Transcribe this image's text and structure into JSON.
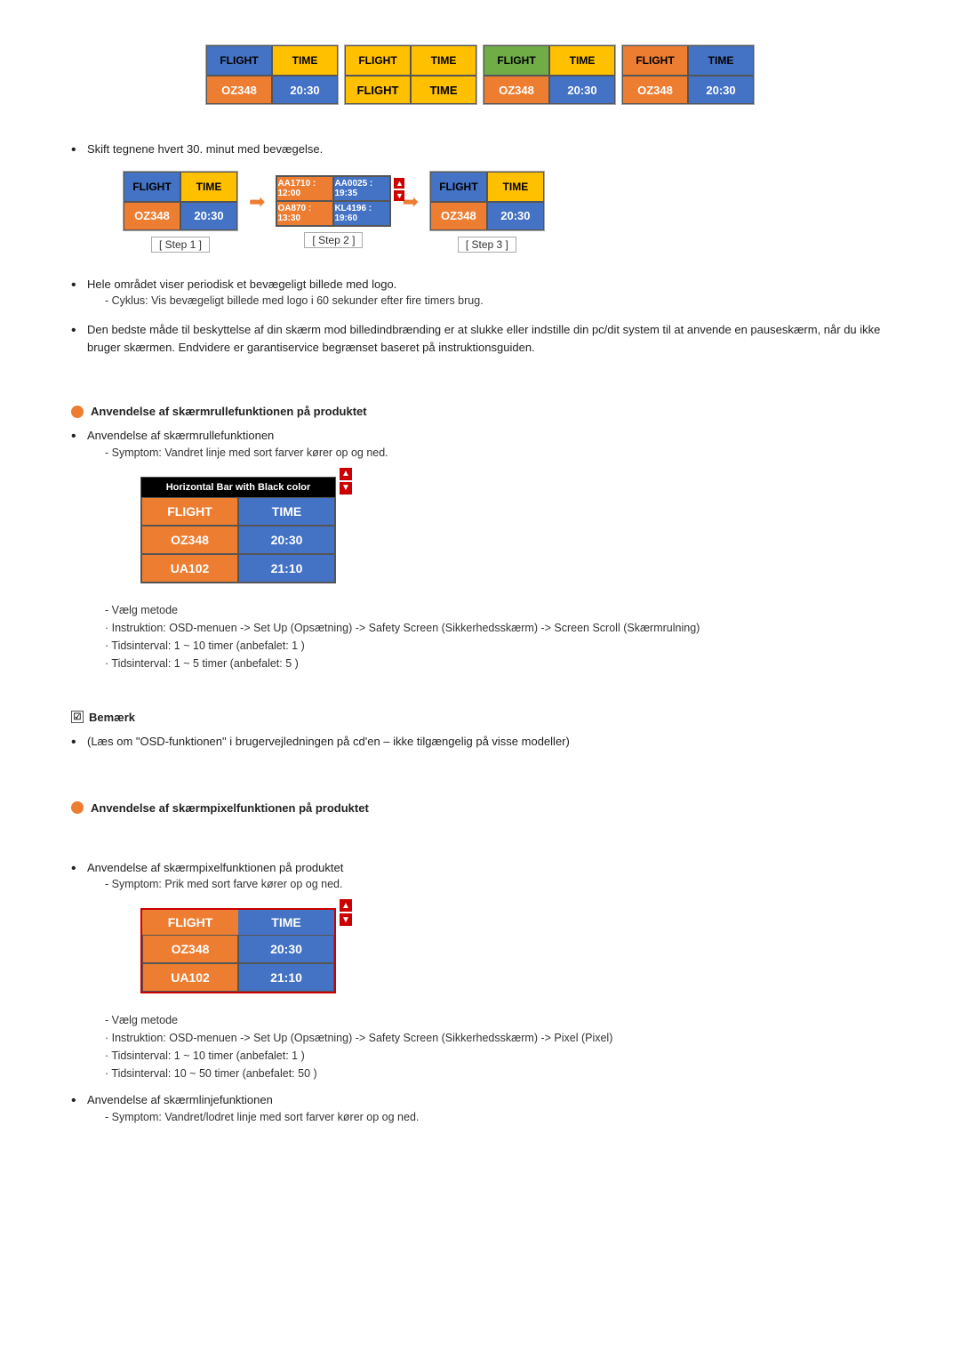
{
  "topCards": [
    {
      "id": "card1",
      "header": [
        {
          "label": "FLIGHT",
          "colorClass": "hdr-blue"
        },
        {
          "label": "TIME",
          "colorClass": "hdr-yellow"
        }
      ],
      "data": [
        {
          "label": "OZ348",
          "colorClass": "dat-orange"
        },
        {
          "label": "20:30",
          "colorClass": "dat-blue"
        }
      ]
    },
    {
      "id": "card2",
      "header": [
        {
          "label": "FLIGHT",
          "colorClass": "hdr-yellow"
        },
        {
          "label": "TIME",
          "colorClass": "hdr-yellow"
        }
      ],
      "data": [
        {
          "label": "FLIGHT",
          "colorClass": "dat-yellow"
        },
        {
          "label": "TIME",
          "colorClass": "dat-yellow"
        }
      ]
    },
    {
      "id": "card3",
      "header": [
        {
          "label": "FLIGHT",
          "colorClass": "hdr-green"
        },
        {
          "label": "TIME",
          "colorClass": "hdr-yellow"
        }
      ],
      "data": [
        {
          "label": "OZ348",
          "colorClass": "dat-orange"
        },
        {
          "label": "20:30",
          "colorClass": "dat-blue"
        }
      ]
    },
    {
      "id": "card4",
      "header": [
        {
          "label": "FLIGHT",
          "colorClass": "hdr-orange"
        },
        {
          "label": "TIME",
          "colorClass": "hdr-blue"
        }
      ],
      "data": [
        {
          "label": "OZ348",
          "colorClass": "dat-orange"
        },
        {
          "label": "20:30",
          "colorClass": "dat-blue"
        }
      ]
    }
  ],
  "bullet1": {
    "text": "Skift tegnene hvert 30. minut med bevægelse.",
    "steps": [
      {
        "label": "[ Step 1 ]"
      },
      {
        "label": "[ Step 2 ]"
      },
      {
        "label": "[ Step 3 ]"
      }
    ],
    "step1Card": {
      "header": [
        {
          "label": "FLIGHT",
          "colorClass": "hdr-blue"
        },
        {
          "label": "TIME",
          "colorClass": "hdr-yellow"
        }
      ],
      "data": [
        {
          "label": "OZ348",
          "colorClass": "dat-orange"
        },
        {
          "label": "20:30",
          "colorClass": "dat-blue"
        }
      ]
    },
    "step3Card": {
      "header": [
        {
          "label": "FLIGHT",
          "colorClass": "hdr-blue"
        },
        {
          "label": "TIME",
          "colorClass": "hdr-yellow"
        }
      ],
      "data": [
        {
          "label": "OZ348",
          "colorClass": "dat-orange"
        },
        {
          "label": "20:30",
          "colorClass": "dat-blue"
        }
      ]
    }
  },
  "bullet2": {
    "text": "Hele området viser periodisk et bevægeligt billede med logo.",
    "sub": "- Cyklus: Vis bevægeligt billede med logo i 60 sekunder efter fire timers brug."
  },
  "bullet3": {
    "text": "Den bedste måde til beskyttelse af din skærm mod billedindbrænding er at slukke eller indstille din pc/dit system til at anvende en pauseskærm, når du ikke bruger skærmen. Endvidere er garantiservice begrænset baseret på instruktionsguiden."
  },
  "scrollSection": {
    "header": "Anvendelse af skærmrullefunktionen på produktet",
    "bullet1": "Anvendelse af skærmrullefunktionen",
    "bullet1sub": "- Symptom: Vandret linje med sort farver kører op og ned.",
    "tableHeader": "Horizontal Bar with Black color",
    "tableRows": [
      {
        "col1": "FLIGHT",
        "col2": "TIME",
        "c1class": "hbar-flight",
        "c2class": "hbar-time"
      },
      {
        "col1": "OZ348",
        "col2": "20:30",
        "c1class": "hbar-oz",
        "c2class": "hbar-2030"
      },
      {
        "col1": "UA102",
        "col2": "21:10",
        "c1class": "hbar-ua",
        "c2class": "hbar-2110"
      }
    ],
    "selectMethod": "- Vælg metode",
    "instructions": [
      "· Instruktion: OSD-menuen -> Set Up (Opsætning) -> Safety Screen (Sikkerhedsskærm) -> Screen Scroll (Skærmrulning)",
      "· Tidsinterval: 1 ~ 10 timer (anbefalet: 1 )",
      "· Tidsinterval: 1 ~ 5 timer (anbefalet: 5 )"
    ]
  },
  "remarkSection": {
    "header": "Bemærk",
    "note": "(Læs om \"OSD-funktionen\" i brugervejledningen på cd'en – ikke tilgængelig på visse modeller)"
  },
  "pixelSection": {
    "header": "Anvendelse af skærmpixelfunktionen på produktet",
    "bullet1": "Anvendelse af skærmpixelfunktionen på produktet",
    "bullet1sub": "- Symptom: Prik med sort farve kører op og ned.",
    "tableRows": [
      {
        "col1": "FLIGHT",
        "col2": "TIME",
        "c1class": "pixel-flight",
        "c2class": "pixel-time"
      },
      {
        "col1": "OZ348",
        "col2": "20:30",
        "c1class": "pixel-oz",
        "c2class": "pixel-2030"
      },
      {
        "col1": "UA102",
        "col2": "21:10",
        "c1class": "pixel-ua",
        "c2class": "pixel-2110"
      }
    ],
    "selectMethod": "- Vælg metode",
    "instructions": [
      "· Instruktion: OSD-menuen -> Set Up (Opsætning) -> Safety Screen (Sikkerhedsskærm) -> Pixel (Pixel)",
      "· Tidsinterval: 1 ~ 10 timer (anbefalet: 1 )",
      "· Tidsinterval: 10 ~ 50 timer (anbefalet: 50 )"
    ],
    "bullet2": "Anvendelse af skærmlinjefunktionen",
    "bullet2sub": "- Symptom: Vandret/lodret linje med sort farver kører op og ned."
  }
}
